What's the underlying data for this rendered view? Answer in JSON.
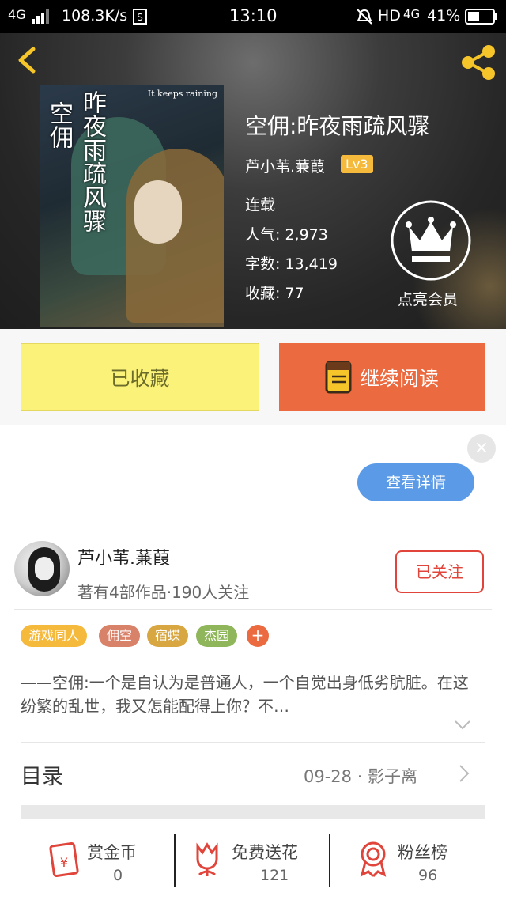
{
  "status_bar": {
    "network": "4G",
    "speed": "108.3K/s",
    "time": "13:10",
    "hd": "HD",
    "network2": "4G",
    "battery": "41%"
  },
  "book": {
    "title": "空佣:昨夜雨疏风骤",
    "author": "芦小苇.蒹葭",
    "level": "Lv3",
    "status": "连载",
    "popularity": "人气: 2,973",
    "word_count": "字数: 13,419",
    "collections": "收藏: 77",
    "cover": {
      "vertical_title": "昨夜雨疏风骤",
      "vertical_sub": "空佣",
      "subtitle": "It keeps raining"
    }
  },
  "vip": {
    "label": "点亮会员"
  },
  "actions": {
    "collected": "已收藏",
    "continue_reading": "继续阅读"
  },
  "ad": {
    "details_button": "查看详情",
    "close": "×"
  },
  "author_card": {
    "name": "芦小苇.蒹葭",
    "stats": "著有4部作品·190人关注",
    "follow_button": "已关注"
  },
  "tags": [
    {
      "label": "游戏同人",
      "color": "#f5b93c"
    },
    {
      "label": "佣空",
      "color": "#d9826a"
    },
    {
      "label": "宿蝶",
      "color": "#d9a741"
    },
    {
      "label": "杰园",
      "color": "#8fb65a"
    }
  ],
  "tag_add": "+",
  "synopsis": "——空佣:一个是自认为是普通人，一个自觉出身低劣肮脏。在这纷繁的乱世，我又怎能配得上你？不…",
  "toc": {
    "title": "目录",
    "info": "09-28 · 影子离"
  },
  "stats": [
    {
      "label": "赏金币",
      "value": "0"
    },
    {
      "label": "免费送花",
      "value": "121"
    },
    {
      "label": "粉丝榜",
      "value": "96"
    }
  ],
  "colors": {
    "accent_orange": "#ec6a3f",
    "accent_yellow": "#fbf27a",
    "follow_red": "#e0443a",
    "details_blue": "#5a9ae6",
    "icon_red": "#e0443a"
  }
}
